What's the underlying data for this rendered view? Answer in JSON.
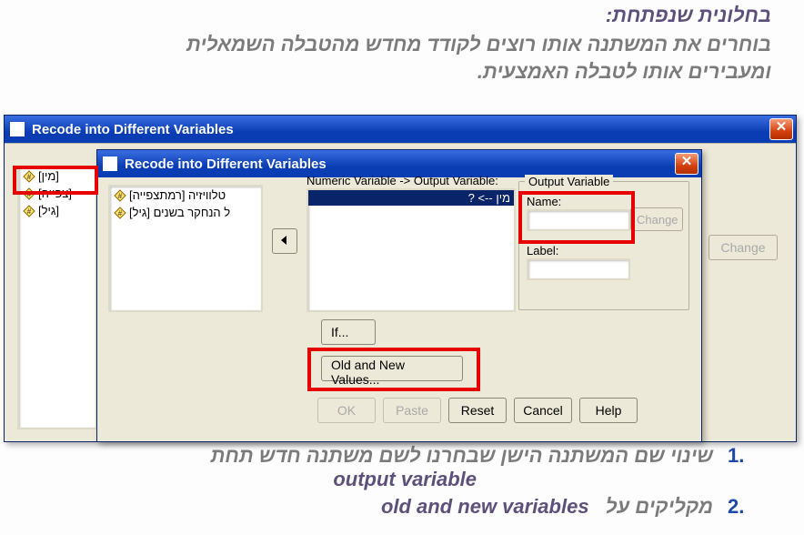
{
  "intro": {
    "line1": "בחלונית שנפתחת:",
    "line2": "בוחרים את המשתנה אותו רוצים לקודד מחדש מהטבלה השמאלית",
    "line3": "ומעבירים אותו לטבלה האמצעית."
  },
  "back_window": {
    "title": "Recode into Different Variables",
    "close": "✕",
    "list": [
      "[מין]",
      "[צפייה]",
      "[גיל]"
    ],
    "change": "Change"
  },
  "front_window": {
    "title": "Recode into Different Variables",
    "close": "✕",
    "var_list": [
      "טלוויזיה [רמתצפייה]",
      "ל הנחקר בשנים [גיל]"
    ],
    "io_label": "Numeric Variable -> Output Variable:",
    "io_selected": "מין --> ?",
    "output_group": {
      "title": "Output Variable",
      "name_label": "Name:",
      "name_value": "",
      "label_label": "Label:",
      "label_value": "",
      "change": "Change"
    },
    "buttons": {
      "if": "If...",
      "onv": "Old and New Values...",
      "ok": "OK",
      "paste": "Paste",
      "reset": "Reset",
      "cancel": "Cancel",
      "help": "Help"
    }
  },
  "steps": {
    "s1_num": ".1",
    "s1_a": "שינוי שם המשתנה הישן שבחרנו לשם משתנה חדש תחת",
    "s1_b": "output variable",
    "s2_num": ".2",
    "s2_a": "מקליקים על",
    "s2_b": "old and new variables"
  }
}
